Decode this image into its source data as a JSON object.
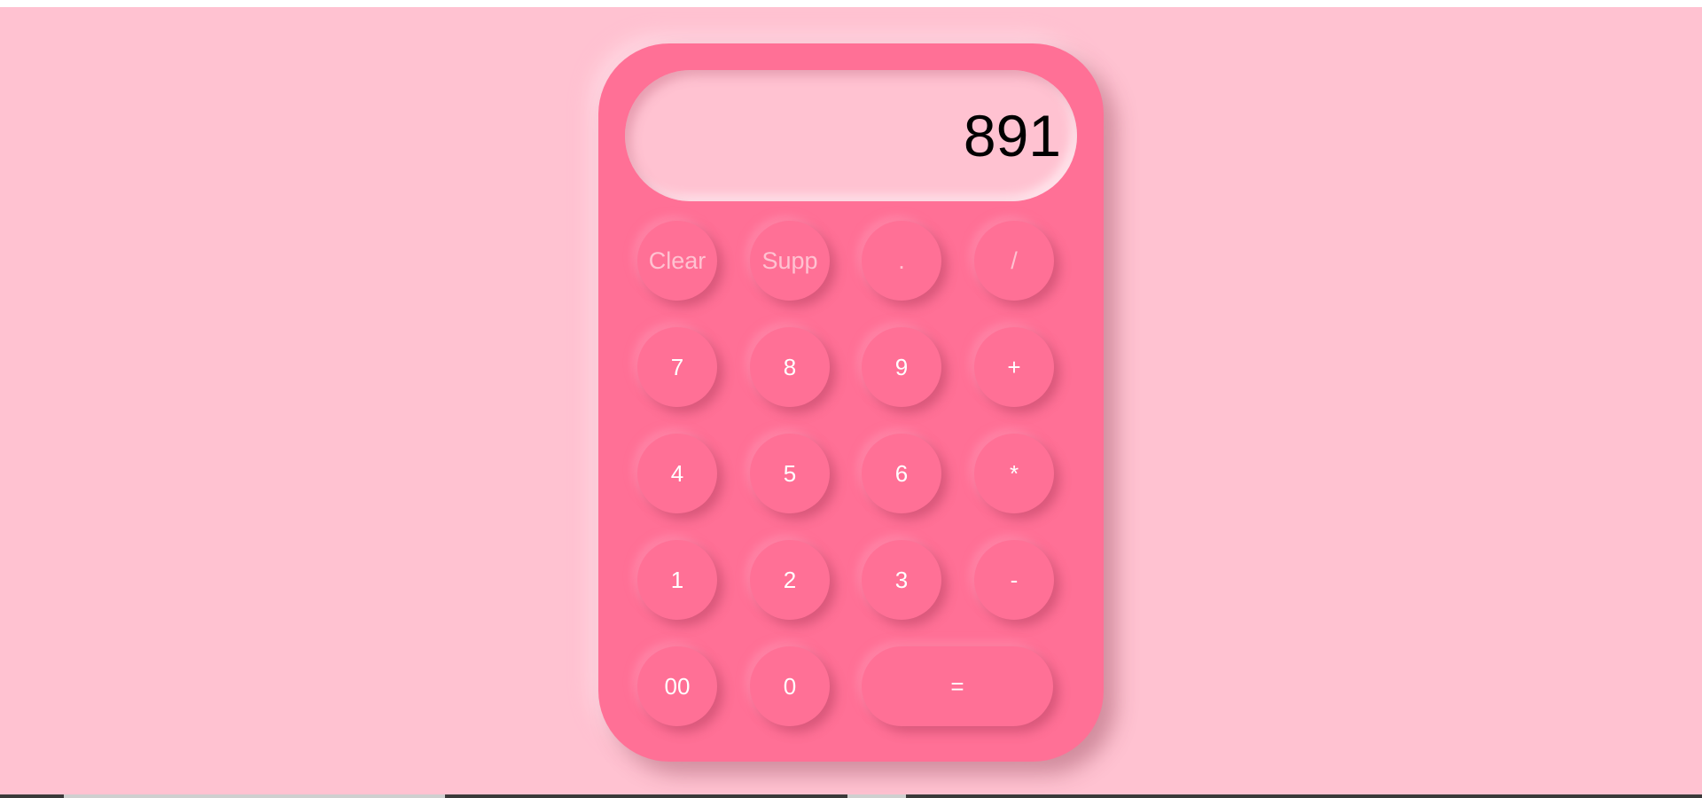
{
  "display": {
    "value": "891"
  },
  "keys": {
    "clear": "Clear",
    "delete": "Supp",
    "decimal": ".",
    "divide": "/",
    "seven": "7",
    "eight": "8",
    "nine": "9",
    "add": "+",
    "four": "4",
    "five": "5",
    "six": "6",
    "multiply": "*",
    "one": "1",
    "two": "2",
    "three": "3",
    "subtract": "-",
    "double_zero": "00",
    "zero": "0",
    "equals": "="
  },
  "colors": {
    "page_background": "#ffc2d1",
    "calculator_body": "#ff7096",
    "key_text": "#ffffff",
    "function_key_text": "#ffc2d1",
    "display_text": "#000000"
  }
}
